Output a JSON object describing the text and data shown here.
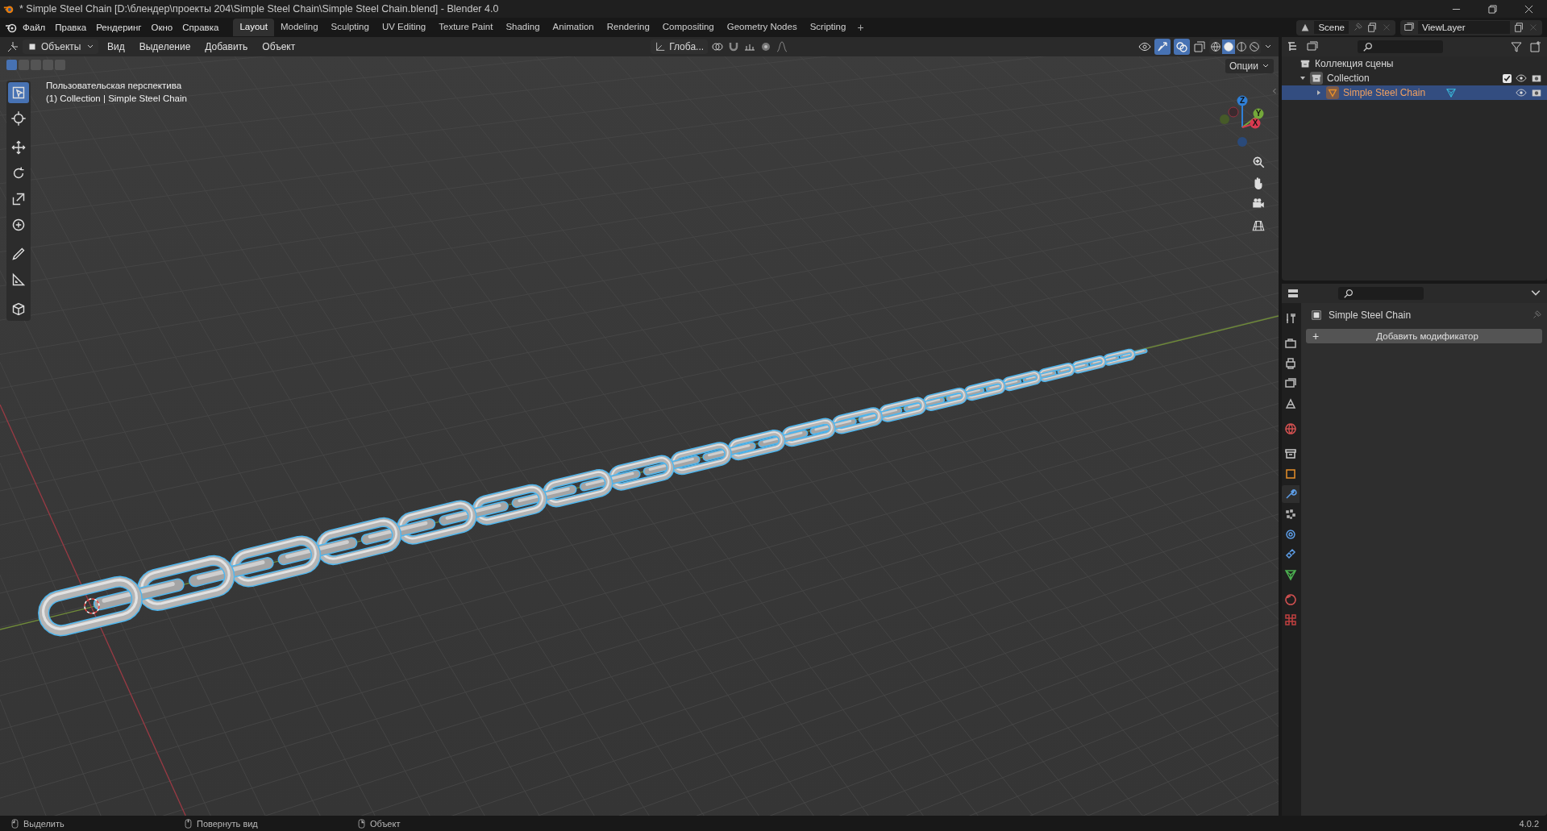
{
  "window": {
    "title": "* Simple Steel Chain [D:\\блендер\\проекты 204\\Simple Steel Chain\\Simple Steel Chain.blend] - Blender 4.0"
  },
  "menu": [
    "Файл",
    "Правка",
    "Рендеринг",
    "Окно",
    "Справка"
  ],
  "workspaces": [
    {
      "label": "Layout",
      "selected": true
    },
    {
      "label": "Modeling",
      "selected": false
    },
    {
      "label": "Sculpting",
      "selected": false
    },
    {
      "label": "UV Editing",
      "selected": false
    },
    {
      "label": "Texture Paint",
      "selected": false
    },
    {
      "label": "Shading",
      "selected": false
    },
    {
      "label": "Animation",
      "selected": false
    },
    {
      "label": "Rendering",
      "selected": false
    },
    {
      "label": "Compositing",
      "selected": false
    },
    {
      "label": "Geometry Nodes",
      "selected": false
    },
    {
      "label": "Scripting",
      "selected": false
    }
  ],
  "add_workspace": "+",
  "scene": {
    "value": "Scene"
  },
  "view_layer": {
    "value": "ViewLayer"
  },
  "viewport": {
    "mode": "Объекты",
    "menus": [
      "Вид",
      "Выделение",
      "Добавить",
      "Объект"
    ],
    "orientation": "Глоба...",
    "options": "Опции",
    "info": [
      "Пользовательская перспектива",
      "(1) Collection | Simple Steel Chain"
    ],
    "select_modes": [
      {
        "selected": true
      },
      {
        "selected": false
      },
      {
        "selected": false
      },
      {
        "selected": false
      },
      {
        "selected": false
      }
    ],
    "toggles": [
      {
        "kind": "gizmo",
        "on": true
      },
      {
        "kind": "overlay",
        "on": true
      }
    ],
    "shading": [
      {
        "kind": "wireframe",
        "selected": false
      },
      {
        "kind": "solid",
        "selected": true
      },
      {
        "kind": "material",
        "selected": false
      },
      {
        "kind": "rendered",
        "selected": false
      }
    ],
    "tools": [
      {
        "kind": "select",
        "selected": true
      },
      {
        "kind": "cursor",
        "selected": false
      },
      {
        "kind": "move",
        "selected": false
      },
      {
        "kind": "rotate",
        "selected": false
      },
      {
        "kind": "scale",
        "selected": false
      },
      {
        "kind": "transform",
        "selected": false
      },
      {
        "kind": "annotate",
        "selected": false
      },
      {
        "kind": "measure",
        "selected": false
      },
      {
        "kind": "add_cube",
        "selected": false
      }
    ],
    "gizmo": [
      {
        "label": "Z",
        "color": "#2f7fd6"
      },
      {
        "label": "Y",
        "color": "#74a83a"
      },
      {
        "label": "X",
        "color": "#d83a50"
      }
    ]
  },
  "outliner": {
    "root": "Коллекция сцены",
    "children": [
      {
        "label": "Collection",
        "expanded": true,
        "checked": true,
        "selected": false,
        "children": [
          {
            "label": "Simple Steel Chain",
            "expanded": false,
            "selected": true
          }
        ]
      }
    ]
  },
  "properties": {
    "tabs": [
      {
        "kind": "tool",
        "selected": false
      },
      {
        "kind": "render",
        "selected": false
      },
      {
        "kind": "output",
        "selected": false
      },
      {
        "kind": "view_layer",
        "selected": false
      },
      {
        "kind": "scene",
        "selected": false
      },
      {
        "kind": "world",
        "selected": false
      },
      {
        "kind": "collection",
        "selected": false
      },
      {
        "kind": "object",
        "selected": false
      },
      {
        "kind": "modifiers",
        "selected": true
      },
      {
        "kind": "particles",
        "selected": false
      },
      {
        "kind": "physics",
        "selected": false
      },
      {
        "kind": "constraints",
        "selected": false
      },
      {
        "kind": "data",
        "selected": false
      },
      {
        "kind": "material",
        "selected": false
      },
      {
        "kind": "texture",
        "selected": false
      }
    ],
    "object": "Simple Steel Chain",
    "add_modifier": {
      "icon": "+",
      "label": "Добавить модификатор"
    }
  },
  "status_bar": {
    "hints": [
      "Выделить",
      "Повернуть вид",
      "Объект"
    ],
    "version": "4.0.2"
  }
}
